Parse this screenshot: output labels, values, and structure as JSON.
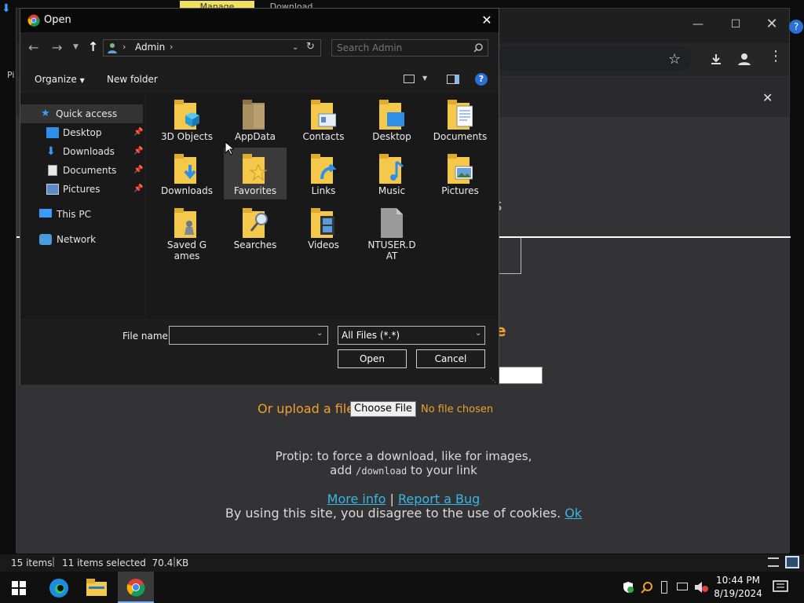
{
  "browser": {
    "tab_label": "Manage",
    "tab2_label": "Download",
    "left_edge_text": "Pi"
  },
  "page": {
    "upload_label": "Or upload a file:",
    "choose_file": "Choose File",
    "no_file": "No file chosen",
    "protip_line1": "Protip: to force a download, like for images,",
    "protip_add": "add",
    "protip_code": "/download",
    "protip_end": "to your link",
    "more_info": "More info",
    "pipe": "|",
    "report_bug": "Report a Bug",
    "cookie_text": "By using this site, you disagree to the use of cookies.",
    "ok": "Ok",
    "partial_char1": "s",
    "partial_char2": "e"
  },
  "dialog": {
    "title": "Open",
    "breadcrumb": "Admin",
    "search_placeholder": "Search Admin",
    "organize": "Organize",
    "new_folder": "New folder",
    "nav": [
      {
        "label": "Quick access",
        "icon": "star-icon",
        "pinned": false
      },
      {
        "label": "Desktop",
        "icon": "desktop-icon",
        "pinned": true
      },
      {
        "label": "Downloads",
        "icon": "download-arrow-icon",
        "pinned": true
      },
      {
        "label": "Documents",
        "icon": "document-icon",
        "pinned": true
      },
      {
        "label": "Pictures",
        "icon": "picture-icon",
        "pinned": true
      },
      {
        "label": "This PC",
        "icon": "computer-icon",
        "pinned": false
      },
      {
        "label": "Network",
        "icon": "network-icon",
        "pinned": false
      }
    ],
    "files": [
      {
        "label": "3D Objects",
        "icon": "folder-3d-icon"
      },
      {
        "label": "AppData",
        "icon": "folder-hidden-icon"
      },
      {
        "label": "Contacts",
        "icon": "folder-contacts-icon"
      },
      {
        "label": "Desktop",
        "icon": "folder-desktop-icon"
      },
      {
        "label": "Documents",
        "icon": "folder-documents-icon"
      },
      {
        "label": "Downloads",
        "icon": "folder-downloads-icon"
      },
      {
        "label": "Favorites",
        "icon": "folder-favorites-icon"
      },
      {
        "label": "Links",
        "icon": "folder-links-icon"
      },
      {
        "label": "Music",
        "icon": "folder-music-icon"
      },
      {
        "label": "Pictures",
        "icon": "folder-pictures-icon"
      },
      {
        "label": "Saved Games",
        "icon": "folder-games-icon"
      },
      {
        "label": "Searches",
        "icon": "folder-search-icon"
      },
      {
        "label": "Videos",
        "icon": "folder-videos-icon"
      },
      {
        "label": "NTUSER.DAT",
        "icon": "file-icon"
      }
    ],
    "file_name_label": "File name:",
    "file_name_value": "",
    "file_type": "All Files (*.*)",
    "open_btn": "Open",
    "cancel_btn": "Cancel"
  },
  "status": {
    "items": "15 items",
    "selected": "11 items selected  70.4 KB"
  },
  "taskbar": {
    "time": "10:44 PM",
    "date": "8/19/2024"
  },
  "colors": {
    "accent_orange": "#f0a030",
    "link_blue": "#39b6e8",
    "folder_yellow": "#f4c84a"
  }
}
